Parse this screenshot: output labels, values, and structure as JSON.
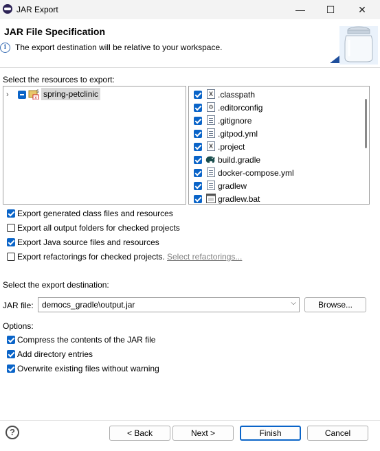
{
  "window": {
    "title": "JAR Export",
    "minimize_glyph": "—",
    "maximize_glyph": "☐",
    "close_glyph": "✕"
  },
  "header": {
    "title": "JAR File Specification",
    "message": "The export destination will be relative to your workspace.",
    "info_glyph": "i"
  },
  "resources": {
    "label": "Select the resources to export:",
    "tree": [
      {
        "label": "spring-petclinic",
        "state": "partial",
        "expanded": false
      }
    ],
    "files": [
      {
        "name": ".classpath",
        "icon": "x-file-icon",
        "checked": true
      },
      {
        "name": ".editorconfig",
        "icon": "gear-file-icon",
        "checked": true
      },
      {
        "name": ".gitignore",
        "icon": "text-file-icon",
        "checked": true
      },
      {
        "name": ".gitpod.yml",
        "icon": "text-file-icon",
        "checked": true
      },
      {
        "name": ".project",
        "icon": "x-file-icon",
        "checked": true
      },
      {
        "name": "build.gradle",
        "icon": "gradle-elephant-icon",
        "checked": true
      },
      {
        "name": "docker-compose.yml",
        "icon": "text-file-icon",
        "checked": true
      },
      {
        "name": "gradlew",
        "icon": "text-file-icon",
        "checked": true
      },
      {
        "name": "gradlew.bat",
        "icon": "batch-file-icon",
        "checked": true
      }
    ]
  },
  "export_options": [
    {
      "label": "Export generated class files and resources",
      "checked": true
    },
    {
      "label": "Export all output folders for checked projects",
      "checked": false
    },
    {
      "label": "Export Java source files and resources",
      "checked": true
    },
    {
      "label": "Export refactorings for checked projects.",
      "checked": false
    }
  ],
  "select_refactorings_link": "Select refactorings...",
  "destination": {
    "label": "Select the export destination:",
    "jar_label": "JAR file:",
    "jar_value": "democs_gradle\\output.jar",
    "browse": "Browse..."
  },
  "options": {
    "label": "Options:",
    "items": [
      {
        "label": "Compress the contents of the JAR file",
        "checked": true
      },
      {
        "label": "Add directory entries",
        "checked": true
      },
      {
        "label": "Overwrite existing files without warning",
        "checked": true
      }
    ]
  },
  "buttons": {
    "help_glyph": "?",
    "back": "< Back",
    "next": "Next >",
    "finish": "Finish",
    "cancel": "Cancel"
  },
  "colors": {
    "accent": "#0a64c8",
    "link_disabled": "#808080"
  }
}
